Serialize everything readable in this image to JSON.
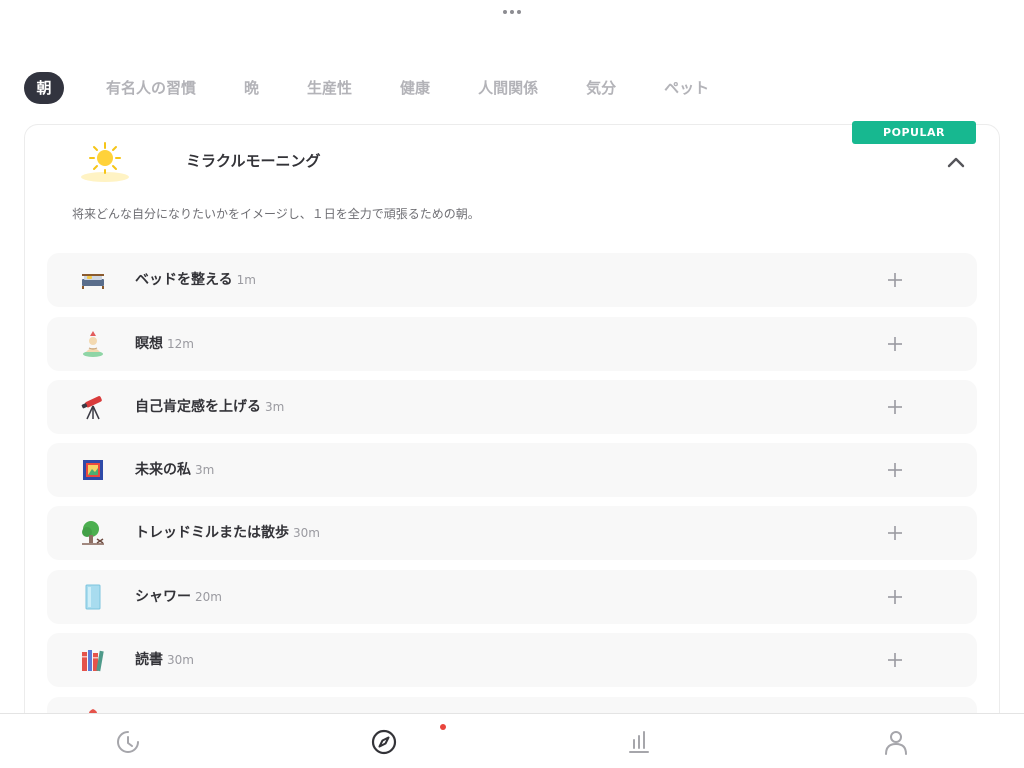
{
  "tabs": [
    {
      "label": "朝",
      "active": true
    },
    {
      "label": "有名人の習慣"
    },
    {
      "label": "晩"
    },
    {
      "label": "生産性"
    },
    {
      "label": "健康"
    },
    {
      "label": "人間関係"
    },
    {
      "label": "気分"
    },
    {
      "label": "ペット"
    }
  ],
  "routine": {
    "badge": "POPULAR",
    "title": "ミラクルモーニング",
    "description": "将来どんな自分になりたいかをイメージし、１日を全力で頑張るための朝。",
    "icon": "sun-icon"
  },
  "habits": [
    {
      "name": "ベッドを整える",
      "duration": "1m",
      "icon": "bed-icon"
    },
    {
      "name": "瞑想",
      "duration": "12m",
      "icon": "meditation-icon"
    },
    {
      "name": "自己肯定感を上げる",
      "duration": "3m",
      "icon": "telescope-icon"
    },
    {
      "name": "未来の私",
      "duration": "3m",
      "icon": "picture-frame-icon"
    },
    {
      "name": "トレッドミルまたは散歩",
      "duration": "30m",
      "icon": "tree-icon"
    },
    {
      "name": "シャワー",
      "duration": "20m",
      "icon": "shower-icon"
    },
    {
      "name": "読書",
      "duration": "30m",
      "icon": "books-icon"
    }
  ],
  "nav": [
    "history-icon",
    "compass-icon",
    "stats-icon",
    "profile-icon"
  ],
  "colors": {
    "accent": "#17b890",
    "active_tab": "#32343f",
    "notification": "#e9443c",
    "row_bg": "#f8f8f8"
  }
}
